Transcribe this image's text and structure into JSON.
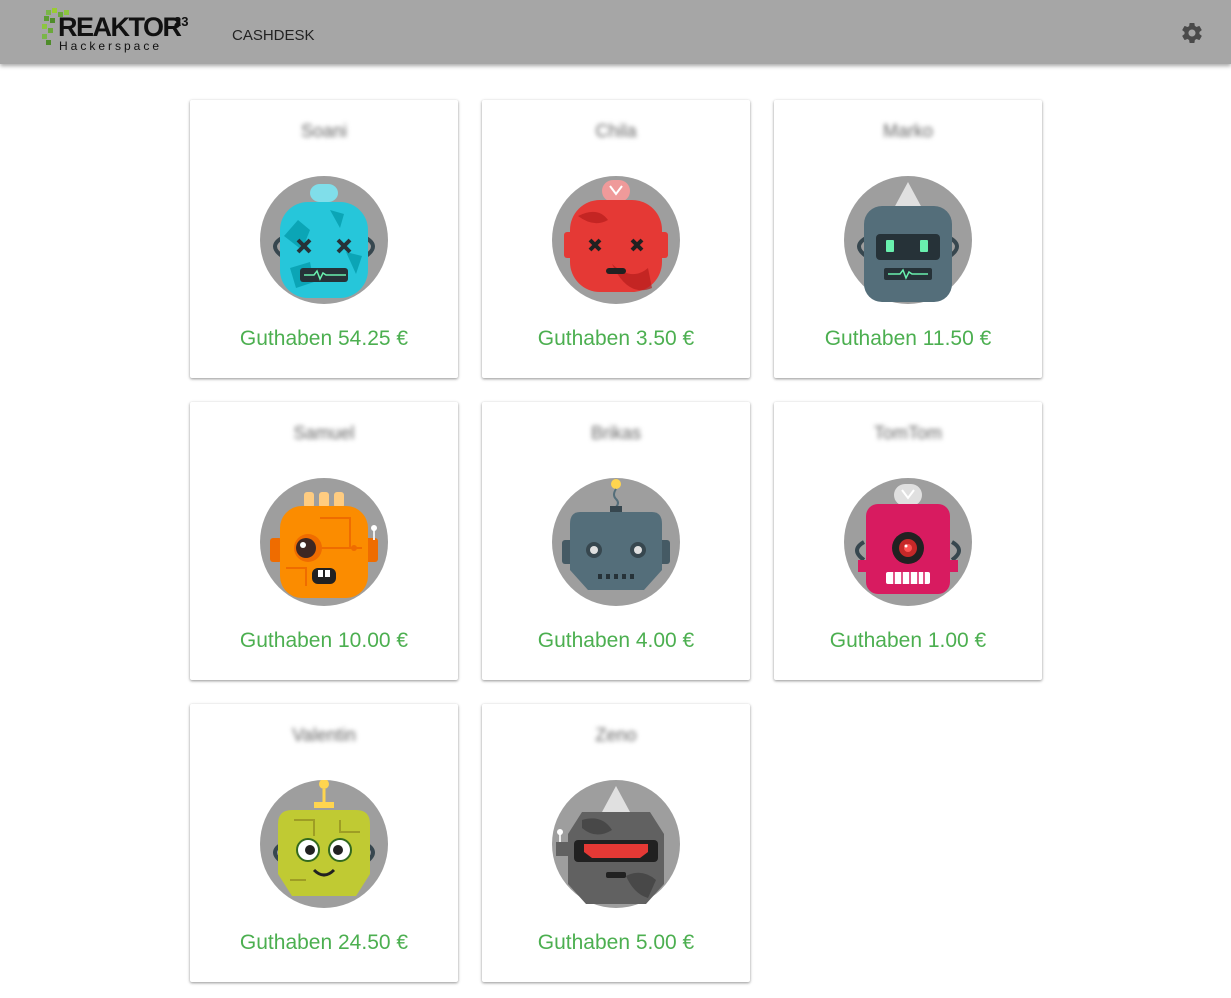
{
  "header": {
    "logo": {
      "name": "REAKTOR",
      "sup": "23",
      "sub": "Hackerspace"
    },
    "nav_link": "CASHDESK",
    "settings_icon": "gear-icon"
  },
  "users": [
    {
      "name": "Soani",
      "balance": "Guthaben 54.25 €",
      "robot": "cyan-robot"
    },
    {
      "name": "Chila",
      "balance": "Guthaben 3.50 €",
      "robot": "red-robot"
    },
    {
      "name": "Marko",
      "balance": "Guthaben 11.50 €",
      "robot": "slate-robot"
    },
    {
      "name": "Samuel",
      "balance": "Guthaben 10.00 €",
      "robot": "orange-robot"
    },
    {
      "name": "Brikas",
      "balance": "Guthaben 4.00 €",
      "robot": "steel-robot"
    },
    {
      "name": "TomTom",
      "balance": "Guthaben 1.00 €",
      "robot": "pink-robot"
    },
    {
      "name": "Valentin",
      "balance": "Guthaben 24.50 €",
      "robot": "lime-robot"
    },
    {
      "name": "Zeno",
      "balance": "Guthaben 5.00 €",
      "robot": "grey-robot"
    }
  ],
  "colors": {
    "topbar": "#a6a6a6",
    "balance_text": "#4caf50",
    "avatar_bg": "#9e9e9e"
  }
}
